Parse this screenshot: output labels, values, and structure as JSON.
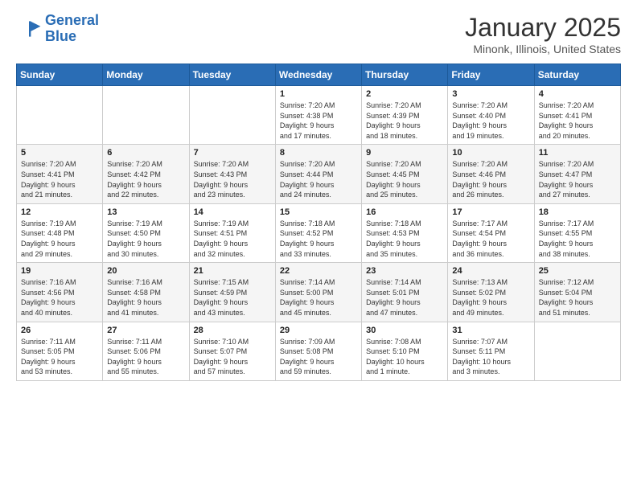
{
  "header": {
    "logo_line1": "General",
    "logo_line2": "Blue",
    "title": "January 2025",
    "subtitle": "Minonk, Illinois, United States"
  },
  "days_of_week": [
    "Sunday",
    "Monday",
    "Tuesday",
    "Wednesday",
    "Thursday",
    "Friday",
    "Saturday"
  ],
  "weeks": [
    [
      {
        "day": "",
        "info": ""
      },
      {
        "day": "",
        "info": ""
      },
      {
        "day": "",
        "info": ""
      },
      {
        "day": "1",
        "info": "Sunrise: 7:20 AM\nSunset: 4:38 PM\nDaylight: 9 hours\nand 17 minutes."
      },
      {
        "day": "2",
        "info": "Sunrise: 7:20 AM\nSunset: 4:39 PM\nDaylight: 9 hours\nand 18 minutes."
      },
      {
        "day": "3",
        "info": "Sunrise: 7:20 AM\nSunset: 4:40 PM\nDaylight: 9 hours\nand 19 minutes."
      },
      {
        "day": "4",
        "info": "Sunrise: 7:20 AM\nSunset: 4:41 PM\nDaylight: 9 hours\nand 20 minutes."
      }
    ],
    [
      {
        "day": "5",
        "info": "Sunrise: 7:20 AM\nSunset: 4:41 PM\nDaylight: 9 hours\nand 21 minutes."
      },
      {
        "day": "6",
        "info": "Sunrise: 7:20 AM\nSunset: 4:42 PM\nDaylight: 9 hours\nand 22 minutes."
      },
      {
        "day": "7",
        "info": "Sunrise: 7:20 AM\nSunset: 4:43 PM\nDaylight: 9 hours\nand 23 minutes."
      },
      {
        "day": "8",
        "info": "Sunrise: 7:20 AM\nSunset: 4:44 PM\nDaylight: 9 hours\nand 24 minutes."
      },
      {
        "day": "9",
        "info": "Sunrise: 7:20 AM\nSunset: 4:45 PM\nDaylight: 9 hours\nand 25 minutes."
      },
      {
        "day": "10",
        "info": "Sunrise: 7:20 AM\nSunset: 4:46 PM\nDaylight: 9 hours\nand 26 minutes."
      },
      {
        "day": "11",
        "info": "Sunrise: 7:20 AM\nSunset: 4:47 PM\nDaylight: 9 hours\nand 27 minutes."
      }
    ],
    [
      {
        "day": "12",
        "info": "Sunrise: 7:19 AM\nSunset: 4:48 PM\nDaylight: 9 hours\nand 29 minutes."
      },
      {
        "day": "13",
        "info": "Sunrise: 7:19 AM\nSunset: 4:50 PM\nDaylight: 9 hours\nand 30 minutes."
      },
      {
        "day": "14",
        "info": "Sunrise: 7:19 AM\nSunset: 4:51 PM\nDaylight: 9 hours\nand 32 minutes."
      },
      {
        "day": "15",
        "info": "Sunrise: 7:18 AM\nSunset: 4:52 PM\nDaylight: 9 hours\nand 33 minutes."
      },
      {
        "day": "16",
        "info": "Sunrise: 7:18 AM\nSunset: 4:53 PM\nDaylight: 9 hours\nand 35 minutes."
      },
      {
        "day": "17",
        "info": "Sunrise: 7:17 AM\nSunset: 4:54 PM\nDaylight: 9 hours\nand 36 minutes."
      },
      {
        "day": "18",
        "info": "Sunrise: 7:17 AM\nSunset: 4:55 PM\nDaylight: 9 hours\nand 38 minutes."
      }
    ],
    [
      {
        "day": "19",
        "info": "Sunrise: 7:16 AM\nSunset: 4:56 PM\nDaylight: 9 hours\nand 40 minutes."
      },
      {
        "day": "20",
        "info": "Sunrise: 7:16 AM\nSunset: 4:58 PM\nDaylight: 9 hours\nand 41 minutes."
      },
      {
        "day": "21",
        "info": "Sunrise: 7:15 AM\nSunset: 4:59 PM\nDaylight: 9 hours\nand 43 minutes."
      },
      {
        "day": "22",
        "info": "Sunrise: 7:14 AM\nSunset: 5:00 PM\nDaylight: 9 hours\nand 45 minutes."
      },
      {
        "day": "23",
        "info": "Sunrise: 7:14 AM\nSunset: 5:01 PM\nDaylight: 9 hours\nand 47 minutes."
      },
      {
        "day": "24",
        "info": "Sunrise: 7:13 AM\nSunset: 5:02 PM\nDaylight: 9 hours\nand 49 minutes."
      },
      {
        "day": "25",
        "info": "Sunrise: 7:12 AM\nSunset: 5:04 PM\nDaylight: 9 hours\nand 51 minutes."
      }
    ],
    [
      {
        "day": "26",
        "info": "Sunrise: 7:11 AM\nSunset: 5:05 PM\nDaylight: 9 hours\nand 53 minutes."
      },
      {
        "day": "27",
        "info": "Sunrise: 7:11 AM\nSunset: 5:06 PM\nDaylight: 9 hours\nand 55 minutes."
      },
      {
        "day": "28",
        "info": "Sunrise: 7:10 AM\nSunset: 5:07 PM\nDaylight: 9 hours\nand 57 minutes."
      },
      {
        "day": "29",
        "info": "Sunrise: 7:09 AM\nSunset: 5:08 PM\nDaylight: 9 hours\nand 59 minutes."
      },
      {
        "day": "30",
        "info": "Sunrise: 7:08 AM\nSunset: 5:10 PM\nDaylight: 10 hours\nand 1 minute."
      },
      {
        "day": "31",
        "info": "Sunrise: 7:07 AM\nSunset: 5:11 PM\nDaylight: 10 hours\nand 3 minutes."
      },
      {
        "day": "",
        "info": ""
      }
    ]
  ]
}
